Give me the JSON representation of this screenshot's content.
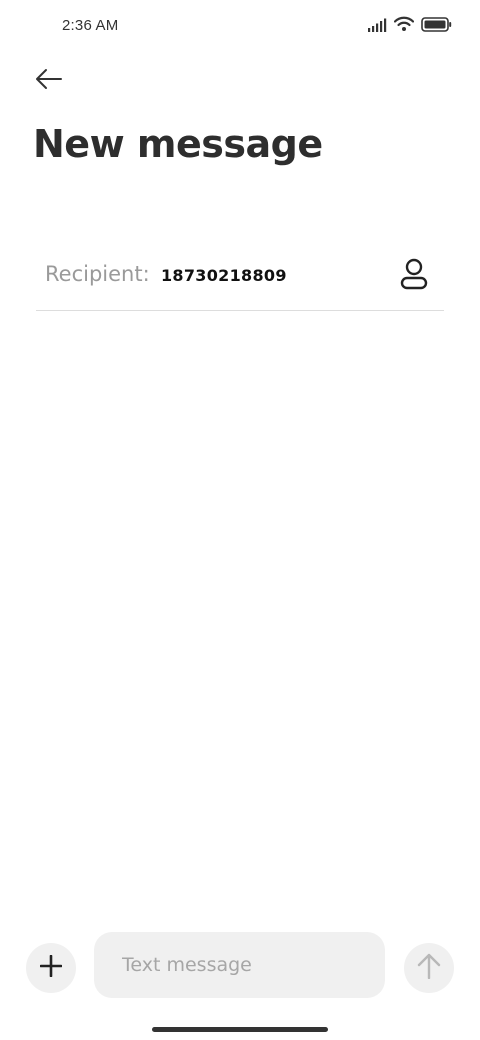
{
  "status_bar": {
    "time": "2:36 AM",
    "icons": [
      "signal-icon",
      "wifi-icon",
      "battery-icon"
    ]
  },
  "header": {
    "back_icon": "back-arrow-icon",
    "title": "New message"
  },
  "recipient": {
    "label": "Recipient:",
    "value": "18730218809",
    "contact_icon": "contact-person-icon"
  },
  "composer": {
    "attach_icon": "plus-icon",
    "placeholder": "Text message",
    "value": "",
    "send_icon": "arrow-up-icon"
  },
  "colors": {
    "text_primary": "#2e2e2e",
    "text_muted": "#9a9a9a",
    "surface": "#f0f0f0",
    "divider": "#dddddd",
    "send_disabled": "#b8b8b8"
  }
}
